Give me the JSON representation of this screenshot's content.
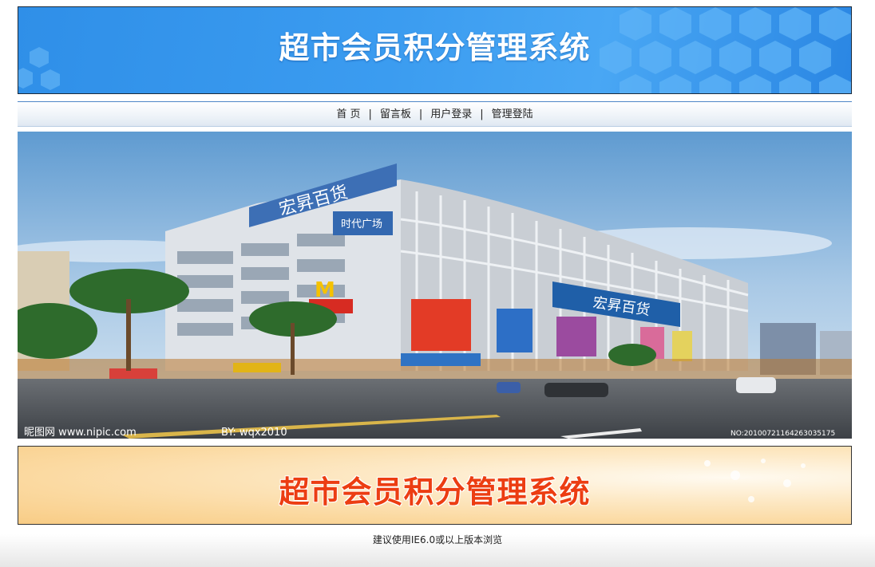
{
  "header": {
    "title": "超市会员积分管理系统"
  },
  "nav": {
    "items": [
      {
        "label": "首 页"
      },
      {
        "label": "留言板"
      },
      {
        "label": "用户登录"
      },
      {
        "label": "管理登陆"
      }
    ],
    "separator": "|"
  },
  "photo": {
    "watermark_left": "昵图网 www.nipic.com",
    "watermark_by": "BY: wqx2010",
    "watermark_right": "NO:20100721164263035175",
    "store_sign": "宏昇百货",
    "plaza_sign": "时代广场"
  },
  "banner_bottom": {
    "title": "超市会员积分管理系统"
  },
  "footer": {
    "text": "建议使用IE6.0或以上版本浏览"
  },
  "colors": {
    "header_blue": "#3b9cf0",
    "banner_orange_text": "#ec3d12"
  }
}
